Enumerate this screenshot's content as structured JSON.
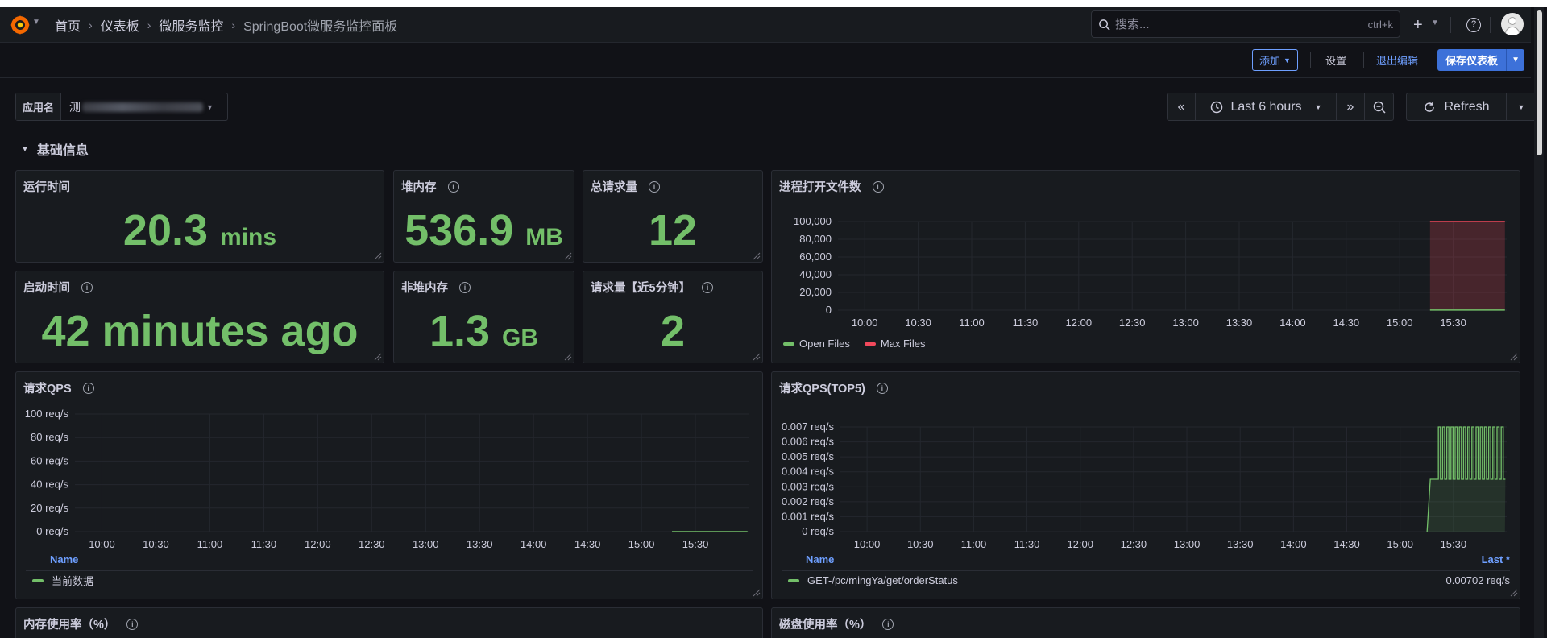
{
  "navbar": {
    "breadcrumbs": [
      "首页",
      "仪表板",
      "微服务监控",
      "SpringBoot微服务监控面板"
    ],
    "search_placeholder": "搜索...",
    "search_shortcut": "ctrl+k",
    "new_icon": "plus-icon",
    "help_icon": "help-icon"
  },
  "toolbar": {
    "add_label": "添加",
    "settings_label": "设置",
    "exit_edit_label": "退出编辑",
    "save_label": "保存仪表板"
  },
  "variables": {
    "app_name_label": "应用名",
    "app_name_value": "测"
  },
  "time_picker": {
    "range_label": "Last 6 hours",
    "refresh_label": "Refresh"
  },
  "row": {
    "title": "基础信息"
  },
  "colors": {
    "green": "#73bf69",
    "red": "#f2495c",
    "accent": "#6e9fff",
    "panel_bg": "#181b1f"
  },
  "stats": {
    "uptime": {
      "title": "运行时间",
      "value": "20.3",
      "unit": "mins"
    },
    "heap": {
      "title": "堆内存",
      "value": "536.9",
      "unit": "MB"
    },
    "total_requests": {
      "title": "总请求量",
      "value": "12"
    },
    "start_time": {
      "title": "启动时间",
      "value": "42 minutes ago"
    },
    "nonheap": {
      "title": "非堆内存",
      "value": "1.3",
      "unit": "GB"
    },
    "requests_5m": {
      "title": "请求量【近5分钟】",
      "value": "2"
    }
  },
  "panels": {
    "open_files": {
      "title": "进程打开文件数"
    },
    "qps": {
      "title": "请求QPS",
      "legend_header": "Name",
      "legend_row": "当前数据"
    },
    "qps_top5": {
      "title": "请求QPS(TOP5)",
      "legend_header_name": "Name",
      "legend_header_last": "Last *",
      "legend_row_name": "GET-/pc/mingYa/get/orderStatus",
      "legend_row_value": "0.00702 req/s"
    },
    "memory_usage": {
      "title": "内存使用率（%）"
    },
    "disk_usage": {
      "title": "磁盘使用率（%）"
    }
  },
  "chart_data": [
    {
      "type": "line",
      "title": "进程打开文件数",
      "x": [
        "10:00",
        "10:30",
        "11:00",
        "11:30",
        "12:00",
        "12:30",
        "13:00",
        "13:30",
        "14:00",
        "14:30",
        "15:00",
        "15:30"
      ],
      "ylim": [
        0,
        100000
      ],
      "yticks": [
        "100,000",
        "80,000",
        "60,000",
        "40,000",
        "20,000",
        "0"
      ],
      "series": [
        {
          "name": "Open Files",
          "color": "#73bf69",
          "from": "15:17",
          "to": "15:59",
          "value": 100
        },
        {
          "name": "Max Files",
          "color": "#f2495c",
          "from": "15:17",
          "to": "15:59",
          "value": 100000
        }
      ],
      "legend": "bottom-left"
    },
    {
      "type": "line",
      "title": "请求QPS",
      "x": [
        "10:00",
        "10:30",
        "11:00",
        "11:30",
        "12:00",
        "12:30",
        "13:00",
        "13:30",
        "14:00",
        "14:30",
        "15:00",
        "15:30"
      ],
      "ylim": [
        0,
        100
      ],
      "yticks": [
        "100 req/s",
        "80 req/s",
        "60 req/s",
        "40 req/s",
        "20 req/s",
        "0 req/s"
      ],
      "series": [
        {
          "name": "当前数据",
          "color": "#73bf69",
          "from": "15:17",
          "to": "15:59",
          "value": 0
        }
      ],
      "legend": "bottom-left"
    },
    {
      "type": "line",
      "title": "请求QPS(TOP5)",
      "x": [
        "10:00",
        "10:30",
        "11:00",
        "11:30",
        "12:00",
        "12:30",
        "13:00",
        "13:30",
        "14:00",
        "14:30",
        "15:00",
        "15:30"
      ],
      "ylim": [
        0,
        0.007
      ],
      "yticks": [
        "0.007 req/s",
        "0.006 req/s",
        "0.005 req/s",
        "0.004 req/s",
        "0.003 req/s",
        "0.002 req/s",
        "0.001 req/s",
        "0 req/s"
      ],
      "series": [
        {
          "name": "GET-/pc/mingYa/get/orderStatus",
          "color": "#73bf69",
          "last": 0.00702,
          "baseline": 0.0035,
          "peak": 0.007,
          "from": "15:17",
          "to": "15:59"
        }
      ],
      "legend": "bottom-left"
    }
  ]
}
